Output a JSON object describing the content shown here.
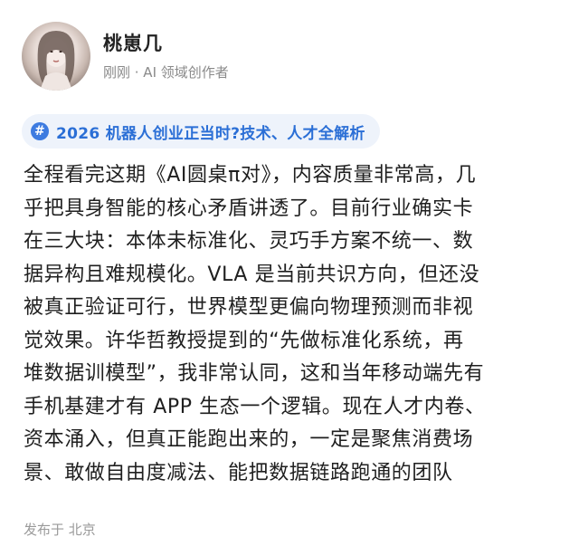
{
  "author": {
    "name": "桃崽几",
    "subtitle": "刚刚 · AI 领域创作者"
  },
  "topic": {
    "icon": "hash-icon",
    "label": "2026 机器人创业正当时?技术、人才全解析"
  },
  "post": {
    "lines": [
      "全程看完这期《AI圆桌π对》，内容质量非常高，几",
      "乎把具身智能的核心矛盾讲透了。目前行业确实卡",
      "在三大块：本体未标准化、灵巧手方案不统一、数",
      "据异构且难规模化。VLA 是当前共识方向，但还没",
      "被真正验证可行，世界模型更偏向物理预测而非视",
      "觉效果。许华哲教授提到的“先做标准化系统，再",
      "堆数据训模型”，我非常认同，这和当年移动端先有",
      "手机基建才有 APP 生态一个逻辑。现在人才内卷、",
      "资本涌入，但真正能跑出来的，一定是聚焦消费场",
      "景、敢做自由度减法、能把数据链路跑通的团队"
    ]
  },
  "footer": {
    "location": "发布于 北京"
  }
}
